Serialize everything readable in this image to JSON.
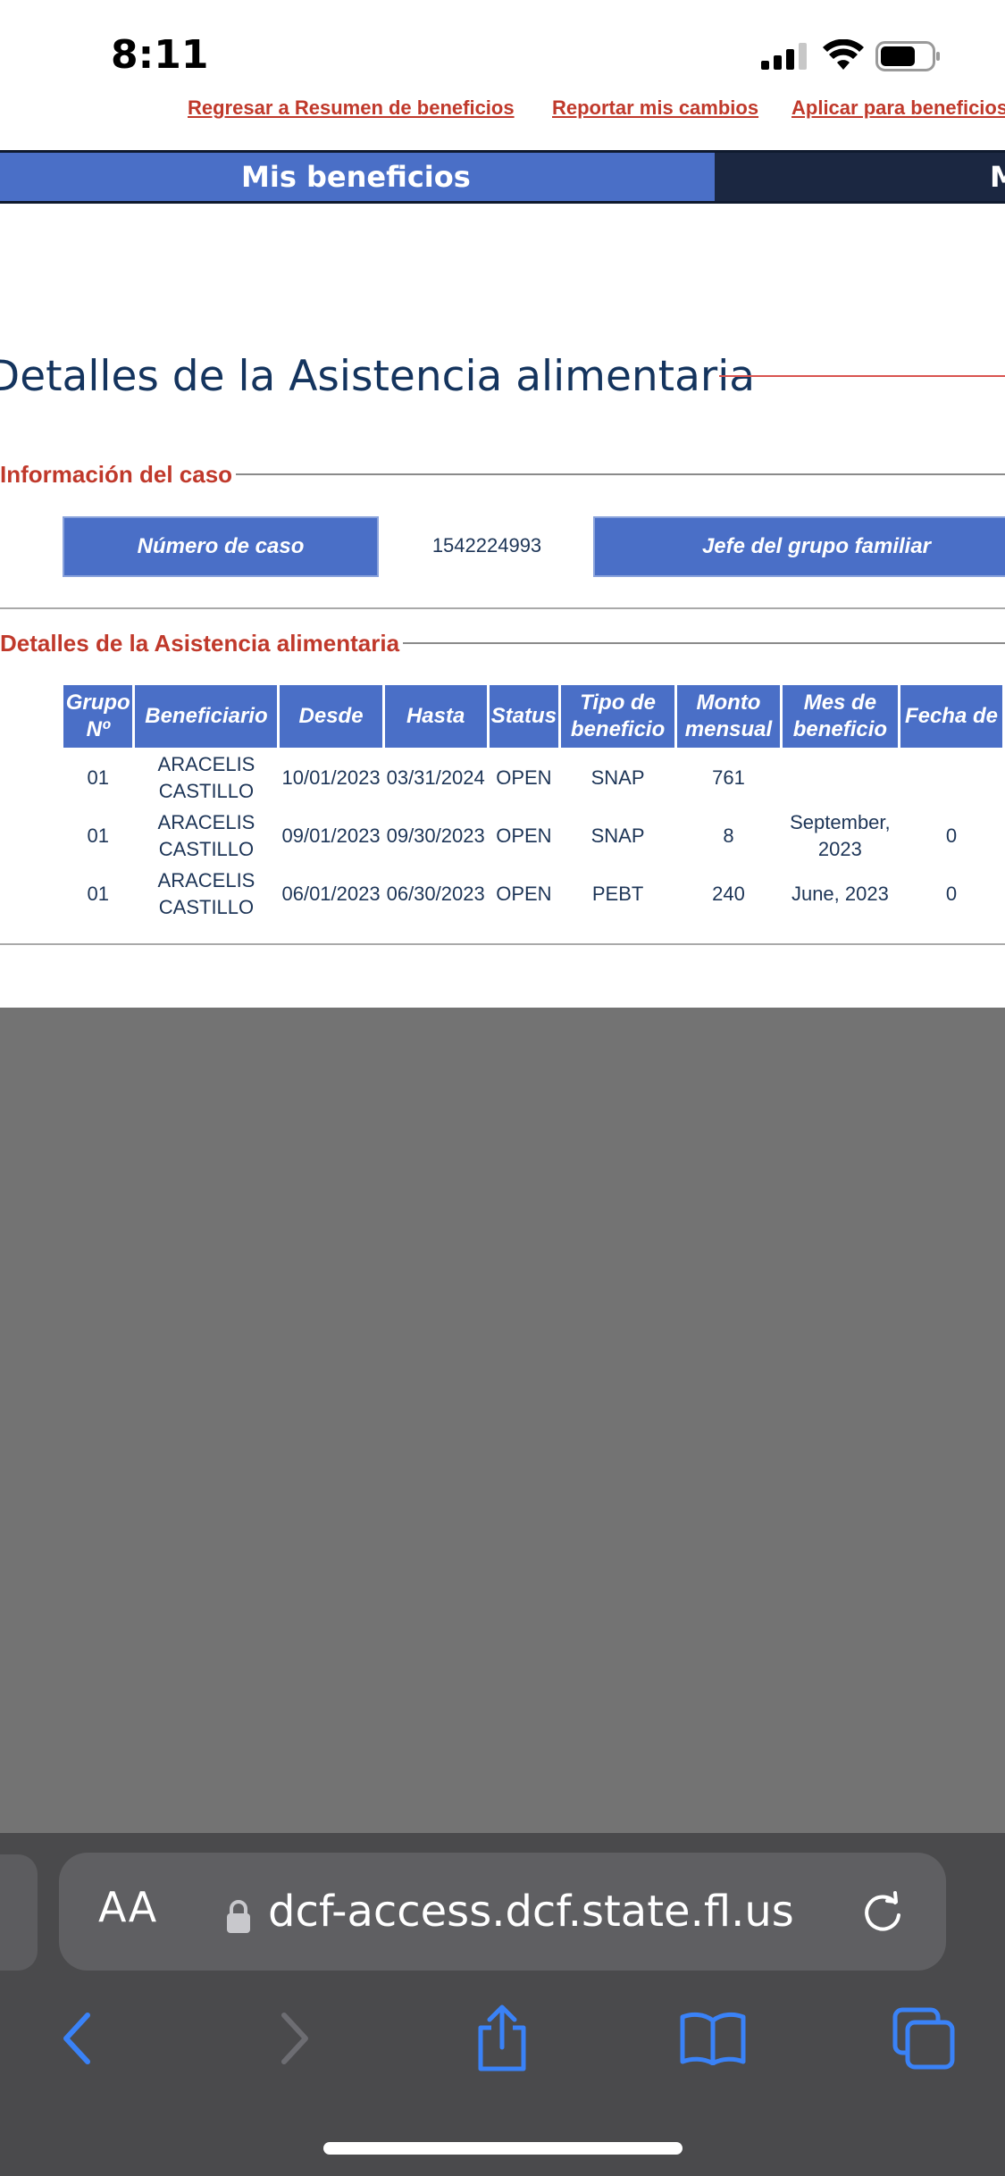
{
  "status_bar": {
    "time": "8:11",
    "icons": [
      "cellular-signal-icon",
      "wifi-icon",
      "battery-icon"
    ]
  },
  "header_links": [
    "Regresar a Resumen de beneficios",
    "Reportar mis cambios",
    "Aplicar para beneficios"
  ],
  "nav": {
    "active_tab": "Mis beneficios",
    "next_tab": "M"
  },
  "page": {
    "title": "Detalles de la Asistencia alimentaria"
  },
  "case_info": {
    "section_title": "Información del caso",
    "case_number_label": "Número de caso",
    "case_number_value": "1542224993",
    "head_of_household_label": "Jefe del grupo familiar"
  },
  "benefits": {
    "section_title": "Detalles de la Asistencia alimentaria",
    "columns": [
      "Grupo Nº",
      "Beneficiario",
      "Desde",
      "Hasta",
      "Status",
      "Tipo de beneficio",
      "Monto mensual",
      "Mes de beneficio",
      "Fecha de"
    ],
    "rows": [
      [
        "01",
        "ARACELIS CASTILLO",
        "10/01/2023",
        "03/31/2024",
        "OPEN",
        "SNAP",
        "761",
        "",
        ""
      ],
      [
        "01",
        "ARACELIS CASTILLO",
        "09/01/2023",
        "09/30/2023",
        "OPEN",
        "SNAP",
        "8",
        "September, 2023",
        "0"
      ],
      [
        "01",
        "ARACELIS CASTILLO",
        "06/01/2023",
        "06/30/2023",
        "OPEN",
        "PEBT",
        "240",
        "June, 2023",
        "0"
      ]
    ]
  },
  "browser": {
    "text_size_label": "AA",
    "url": "dcf-access.dcf.state.fl.us",
    "toolbar": [
      "back-icon",
      "forward-icon",
      "share-icon",
      "bookmarks-icon",
      "tabs-icon"
    ]
  },
  "colors": {
    "accent_blue": "#4a6fc7",
    "nav_dark": "#1b2741",
    "section_red": "#c0392b",
    "title_navy": "#14345e",
    "safari_gray": "#4a4a4c",
    "system_blue": "#3a82f7"
  }
}
